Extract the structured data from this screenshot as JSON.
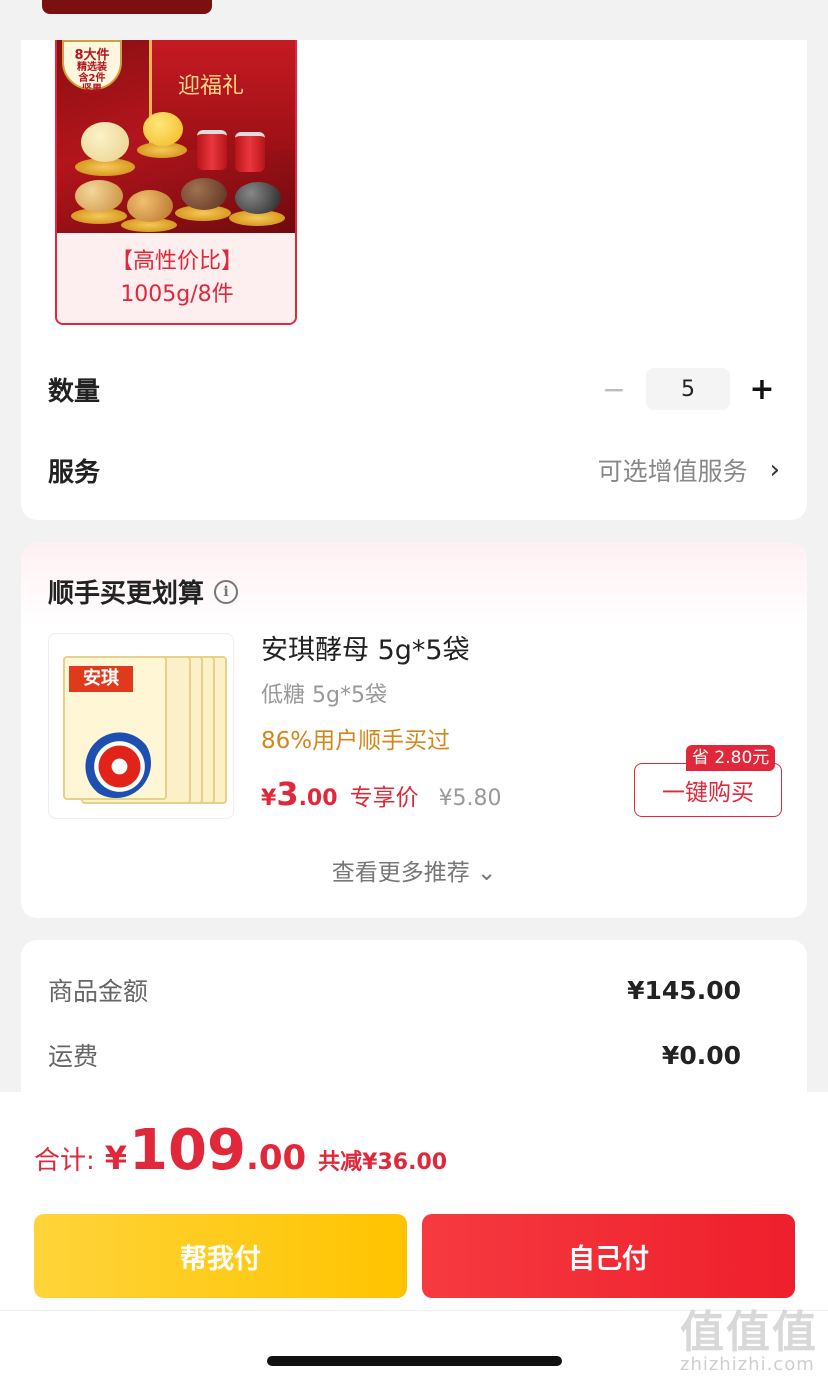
{
  "product": {
    "sku_badge_lines": [
      "8大件",
      "精选装",
      "含2件",
      "坚果"
    ],
    "sku_box_text": "迎福礼",
    "sku_label_line1": "【高性价比】",
    "sku_label_line2": "1005g/8件"
  },
  "quantity": {
    "label": "数量",
    "minus": "−",
    "value": "5",
    "plus": "+"
  },
  "service": {
    "label": "服务",
    "value": "可选增值服务",
    "chevron": "›"
  },
  "recommend": {
    "title": "顺手买更划算",
    "info_icon": "i",
    "item": {
      "brand": "安琪",
      "name": "安琪酵母 5g*5袋",
      "spec": "低糖 5g*5袋",
      "bought": "86%用户顺手买过",
      "price_yen": "¥",
      "price_int": "3",
      "price_dec": ".00",
      "price_tag": "专享价",
      "price_orig": "¥5.80",
      "save_badge": "省 2.80元",
      "buy_label": "一键购买"
    },
    "more": "查看更多推荐 ⌄"
  },
  "amounts": {
    "goods_label": "商品金额",
    "goods_value": "¥145.00",
    "shipping_label": "运费",
    "shipping_value": "¥0.00"
  },
  "checkout": {
    "total_label": "合计:",
    "total_yen": "¥",
    "total_int": "109",
    "total_dec": ".00",
    "total_saved": "共减¥36.00",
    "help_pay": "帮我付",
    "self_pay": "自己付"
  },
  "watermark": {
    "logo": "值值值",
    "text": "zhizhizhi.com"
  },
  "colors": {
    "accent_red": "#e0283a",
    "yellow": "#ffc400",
    "orange_text": "#d4861a"
  }
}
